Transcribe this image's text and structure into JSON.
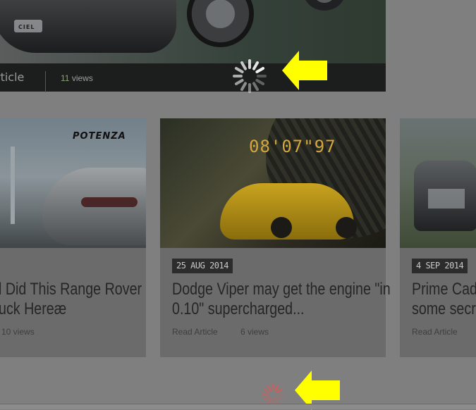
{
  "hero": {
    "title": "rticle",
    "views_count": "11",
    "views_label": "views",
    "badge_text": "CIEL"
  },
  "cards": [
    {
      "image_brand": "POTENZA",
      "date": "",
      "title_line1": "l Did This Range Rover",
      "title_line2": "uck Hereæ",
      "read_label": "",
      "views": "10 views"
    },
    {
      "image_timer": "08'07\"97",
      "date": "25 AUG 2014",
      "title_line1": "Dodge Viper may get the engine \"in",
      "title_line2": "0.10\" supercharged...",
      "read_label": "Read Article",
      "views": "6 views"
    },
    {
      "date": "4 SEP 2014",
      "title_line1": "Prime Cadill",
      "title_line2": "some secret",
      "read_label": "Read Article",
      "views": ""
    }
  ],
  "colors": {
    "overlay": "#7f7f7f",
    "arrow": "#ffff00",
    "spinner_top": "#ffffff",
    "spinner_bottom": "#c76060"
  },
  "icons": {
    "top_spinner": "loading-spinner-icon",
    "bottom_spinner": "loading-spinner-icon",
    "arrow": "arrow-left-icon"
  }
}
